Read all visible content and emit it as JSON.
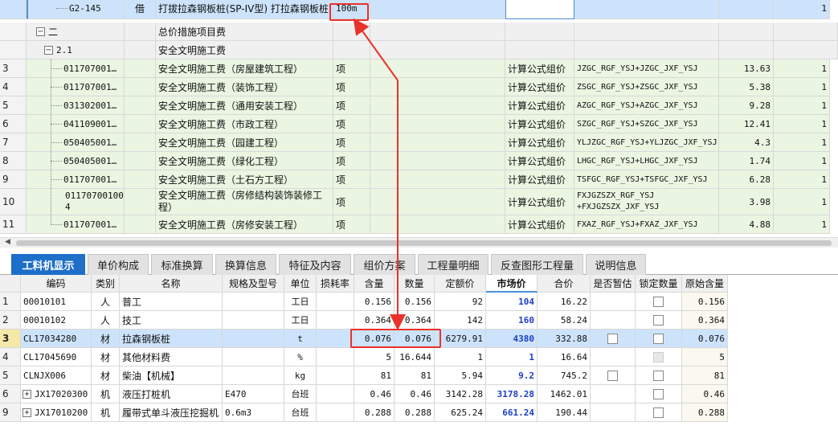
{
  "top": {
    "row_g2": {
      "code": "G2-145",
      "borrow": "借",
      "name": "打拔拉森钢板桩(SP-IV型) 打拉森钢板桩",
      "unit": "100m",
      "qty": "1"
    },
    "row_two": {
      "code": "二",
      "name": "总价措施项目费"
    },
    "row_21": {
      "code": "2.1",
      "name": "安全文明施工费"
    },
    "rows": [
      {
        "n": "3",
        "code": "011707001…",
        "name": "安全文明施工费（房屋建筑工程）",
        "unit": "项",
        "method": "计算公式组价",
        "formula": "JZGC_RGF_YSJ+JZGC_JXF_YSJ",
        "value": "13.63",
        "qty": "1"
      },
      {
        "n": "4",
        "code": "011707001…",
        "name": "安全文明施工费（装饰工程）",
        "unit": "项",
        "method": "计算公式组价",
        "formula": "ZSGC_RGF_YSJ+ZSGC_JXF_YSJ",
        "value": "5.38",
        "qty": "1"
      },
      {
        "n": "5",
        "code": "031302001…",
        "name": "安全文明施工费（通用安装工程）",
        "unit": "项",
        "method": "计算公式组价",
        "formula": "AZGC_RGF_YSJ+AZGC_JXF_YSJ",
        "value": "9.28",
        "qty": "1"
      },
      {
        "n": "6",
        "code": "041109001…",
        "name": "安全文明施工费（市政工程）",
        "unit": "项",
        "method": "计算公式组价",
        "formula": "SZGC_RGF_YSJ+SZGC_JXF_YSJ",
        "value": "12.41",
        "qty": "1"
      },
      {
        "n": "7",
        "code": "050405001…",
        "name": "安全文明施工费（园建工程）",
        "unit": "项",
        "method": "计算公式组价",
        "formula": "YLJZGC_RGF_YSJ+YLJZGC_JXF_YSJ",
        "value": "4.3",
        "qty": "1"
      },
      {
        "n": "8",
        "code": "050405001…",
        "name": "安全文明施工费（绿化工程）",
        "unit": "项",
        "method": "计算公式组价",
        "formula": "LHGC_RGF_YSJ+LHGC_JXF_YSJ",
        "value": "1.74",
        "qty": "1"
      },
      {
        "n": "9",
        "code": "011707001…",
        "name": "安全文明施工费（土石方工程）",
        "unit": "项",
        "method": "计算公式组价",
        "formula": "TSFGC_RGF_YSJ+TSFGC_JXF_YSJ",
        "value": "6.28",
        "qty": "1"
      }
    ],
    "row10": {
      "n": "10",
      "code1": "01170700100",
      "code2": "4",
      "name1": "安全文明施工费（房修结构装饰装修工",
      "name2": "程）",
      "unit": "项",
      "method": "计算公式组价",
      "formula1": "FXJGZSZX_RGF_YSJ",
      "formula2": "+FXJGZSZX_JXF_YSJ",
      "value": "3.98",
      "qty": "1"
    },
    "row11": {
      "n": "11",
      "code": "011707001…",
      "name": "安全文明施工费（房修安装工程）",
      "unit": "项",
      "method": "计算公式组价",
      "formula": "FXAZ_RGF_YSJ+FXAZ_JXF_YSJ",
      "value": "4.88",
      "qty": "1"
    }
  },
  "tabs": [
    "工料机显示",
    "单价构成",
    "标准换算",
    "换算信息",
    "特征及内容",
    "组价方案",
    "工程量明细",
    "反查图形工程量",
    "说明信息"
  ],
  "bottom": {
    "headers": [
      "编码",
      "类别",
      "名称",
      "规格及型号",
      "单位",
      "损耗率",
      "含量",
      "数量",
      "定额价",
      "市场价",
      "合价",
      "是否暂估",
      "锁定数量",
      "原始含量"
    ],
    "rows": [
      {
        "n": "1",
        "code": "00010101",
        "cat": "人",
        "name": "普工",
        "spec": "",
        "unit": "工日",
        "loss": "",
        "content": "0.156",
        "qty": "0.156",
        "quota": "92",
        "market": "104",
        "total": "16.22",
        "est": false,
        "lock": true,
        "orig": "0.156",
        "expand": false
      },
      {
        "n": "2",
        "code": "00010102",
        "cat": "人",
        "name": "技工",
        "spec": "",
        "unit": "工日",
        "loss": "",
        "content": "0.364",
        "qty": "0.364",
        "quota": "142",
        "market": "160",
        "total": "58.24",
        "est": false,
        "lock": true,
        "orig": "0.364",
        "expand": false
      },
      {
        "n": "3",
        "code": "CL17034280",
        "cat": "材",
        "name": "拉森钢板桩",
        "spec": "",
        "unit": "t",
        "loss": "",
        "content": "0.076",
        "qty": "0.076",
        "quota": "6279.91",
        "market": "4380",
        "total": "332.88",
        "est": true,
        "lock": true,
        "orig": "0.076",
        "expand": false
      },
      {
        "n": "4",
        "code": "CL17045690",
        "cat": "材",
        "name": "其他材料费",
        "spec": "",
        "unit": "%",
        "loss": "",
        "content": "5",
        "qty": "16.644",
        "quota": "1",
        "market": "1",
        "total": "16.64",
        "est": false,
        "lock": "dis",
        "orig": "5",
        "expand": false
      },
      {
        "n": "5",
        "code": "CLNJX006",
        "cat": "材",
        "name": "柴油【机械】",
        "spec": "",
        "unit": "kg",
        "loss": "",
        "content": "81",
        "qty": "81",
        "quota": "5.94",
        "market": "9.2",
        "total": "745.2",
        "est": true,
        "lock": true,
        "orig": "81",
        "expand": false
      },
      {
        "n": "6",
        "code": "JX17020300",
        "cat": "机",
        "name": "液压打桩机",
        "spec": "E470",
        "unit": "台班",
        "loss": "",
        "content": "0.46",
        "qty": "0.46",
        "quota": "3142.28",
        "market": "3178.28",
        "total": "1462.01",
        "est": false,
        "lock": true,
        "orig": "0.46",
        "expand": true
      },
      {
        "n": "9",
        "code": "JX17010200",
        "cat": "机",
        "name": "履带式单斗液压挖掘机",
        "spec": "0.6m3",
        "unit": "台班",
        "loss": "",
        "content": "0.288",
        "qty": "0.288",
        "quota": "625.24",
        "market": "661.24",
        "total": "190.44",
        "est": false,
        "lock": true,
        "orig": "0.288",
        "expand": true
      }
    ]
  },
  "colors": {
    "accent": "#1d6fc8",
    "selection": "#cde3fb",
    "market_price": "#1a3ec7",
    "highlight": "#e8322b",
    "tree_green": "#eaf5e2"
  }
}
